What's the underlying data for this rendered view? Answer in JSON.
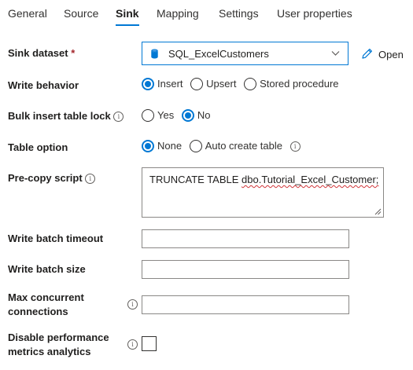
{
  "tabs": [
    {
      "label": "General"
    },
    {
      "label": "Source"
    },
    {
      "label": "Sink",
      "active": true
    },
    {
      "label": "Mapping"
    },
    {
      "label": "Settings"
    },
    {
      "label": "User properties"
    }
  ],
  "sink_dataset": {
    "label": "Sink dataset",
    "required_marker": "*",
    "value": "SQL_ExcelCustomers",
    "open_label": "Open",
    "icon": "database-icon"
  },
  "write_behavior": {
    "label": "Write behavior",
    "options": [
      "Insert",
      "Upsert",
      "Stored procedure"
    ],
    "selected": "Insert"
  },
  "bulk_insert_table_lock": {
    "label": "Bulk insert table lock",
    "options": [
      "Yes",
      "No"
    ],
    "selected": "No"
  },
  "table_option": {
    "label": "Table option",
    "options": [
      "None",
      "Auto create table"
    ],
    "selected": "None"
  },
  "pre_copy_script": {
    "label": "Pre-copy script",
    "value_prefix": "TRUNCATE TABLE ",
    "value_flagged": "dbo.Tutorial_Excel_Customer;"
  },
  "write_batch_timeout": {
    "label": "Write batch timeout",
    "value": ""
  },
  "write_batch_size": {
    "label": "Write batch size",
    "value": ""
  },
  "max_concurrent_connections": {
    "label": "Max concurrent connections",
    "value": ""
  },
  "disable_performance_metrics_analytics": {
    "label": "Disable performance metrics analytics",
    "checked": false
  },
  "info_glyph": "i",
  "colors": {
    "accent": "#0078d4",
    "text": "#323130",
    "required": "#a4262c",
    "spellcheck": "#d13438"
  }
}
